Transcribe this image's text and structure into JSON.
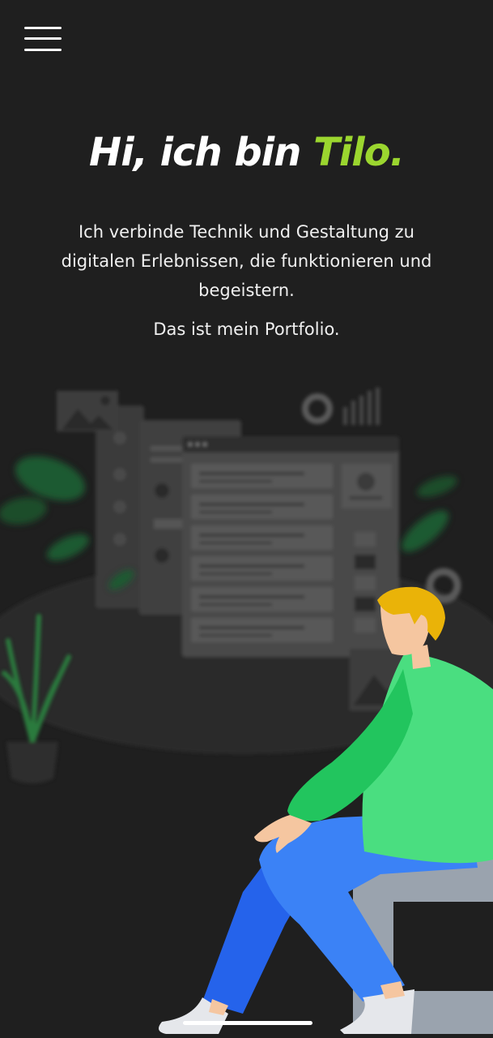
{
  "menu": {
    "icon": "hamburger-menu-icon"
  },
  "hero": {
    "title_prefix": "Hi, ich bin ",
    "title_name": "Tilo",
    "title_suffix": ".",
    "accent_color": "#9bd62f",
    "intro": "Ich verbinde Technik und Gestaltung zu digitalen Erlebnissen, die funktionieren und begeistern.",
    "tagline": "Das ist mein Portfolio."
  },
  "illustration": {
    "icon": "developer-at-dashboard-illustration"
  },
  "colors": {
    "background": "#1f1f1f",
    "shirt": "#4ade80",
    "pants": "#3b82f6",
    "hair": "#eab308"
  }
}
